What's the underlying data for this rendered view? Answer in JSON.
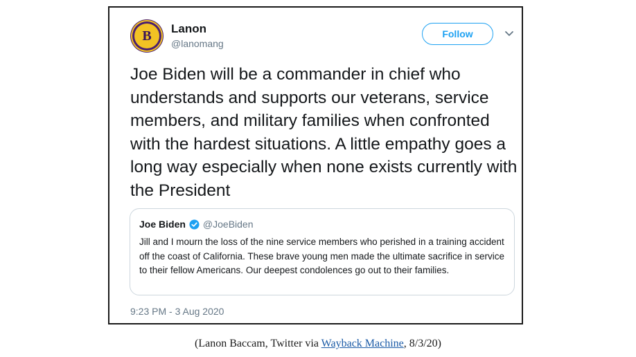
{
  "tweet": {
    "display_name": "Lanon",
    "handle": "@lanomang",
    "avatar_letter": "B",
    "follow_label": "Follow",
    "text": "Joe Biden will be a commander in chief who understands and supports our veterans, service members, and military families when confronted with the hardest situations. A little empathy goes a long way especially when none exists currently with the President",
    "timestamp": "9:23 PM - 3 Aug 2020",
    "quote": {
      "display_name": "Joe Biden",
      "handle": "@JoeBiden",
      "text": "Jill and I mourn the loss of the nine service members who perished in a training accident off the coast of California. These brave young men made the ultimate sacrifice in service to their fellow Americans. Our deepest condolences go out to their families."
    }
  },
  "caption": {
    "prefix": "(Lanon Baccam, Twitter via ",
    "link_text": "Wayback Machine",
    "suffix": ", 8/3/20)"
  },
  "colors": {
    "accent": "#1da1f2",
    "secondary_text": "#657786",
    "avatar_bg": "#4b1f6f",
    "avatar_fg": "#f2c224",
    "caption_link": "#1a5aa6"
  }
}
